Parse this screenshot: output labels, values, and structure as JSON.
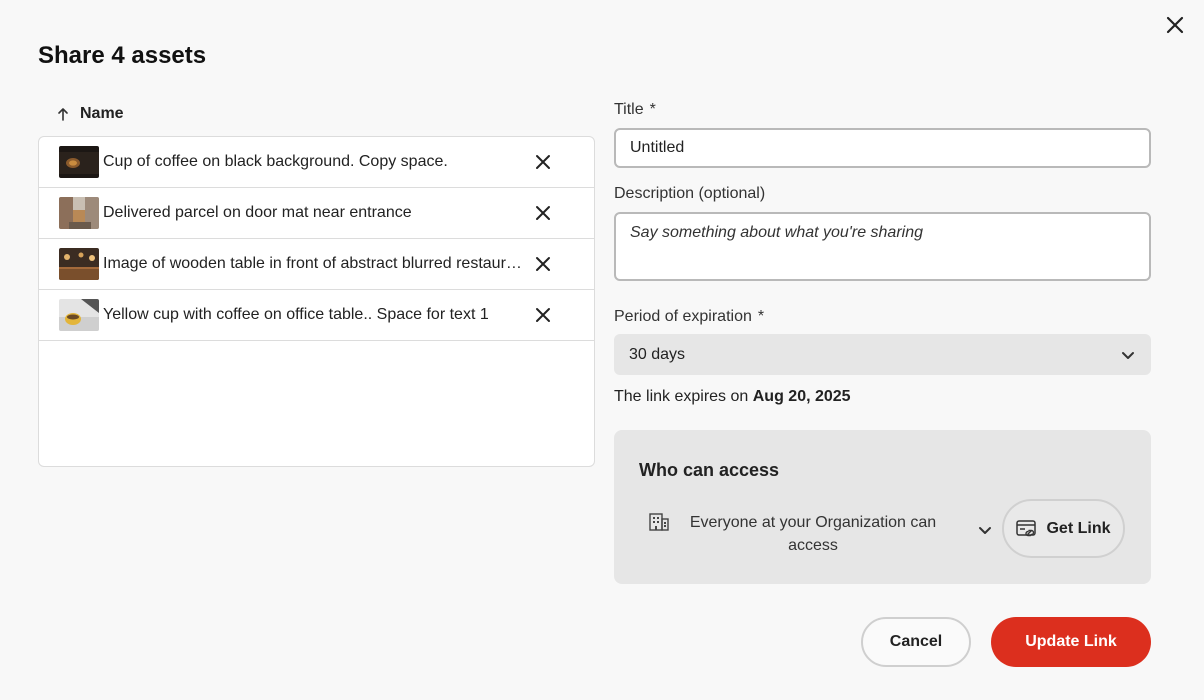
{
  "dialog": {
    "title": "Share 4 assets",
    "close_icon": "close-icon"
  },
  "asset_list": {
    "sort_column": "Name",
    "sort_icon": "arrow-up-icon",
    "items": [
      {
        "name": "Cup of coffee on black background. Copy space.",
        "thumb": "coffee-cup-thumbnail"
      },
      {
        "name": "Delivered parcel on door mat near entrance",
        "thumb": "parcel-thumbnail"
      },
      {
        "name": "Image of wooden table in front of abstract blurred restaurant",
        "thumb": "wooden-table-thumbnail"
      },
      {
        "name": "Yellow cup with coffee on office table.. Space for text 1",
        "thumb": "yellow-cup-thumbnail"
      }
    ]
  },
  "form": {
    "title_label": "Title",
    "required_mark": "*",
    "title_value": "Untitled",
    "description_label": "Description (optional)",
    "description_placeholder": "Say something about what you're sharing",
    "expiration_label": "Period of expiration",
    "expiration_value": "30 days",
    "expires_prefix": "The link expires on",
    "expires_date": "Aug 20, 2025"
  },
  "access": {
    "title": "Who can access",
    "scope_text": "Everyone at your Organization can access",
    "get_link_label": "Get Link"
  },
  "footer": {
    "cancel_label": "Cancel",
    "update_label": "Update Link"
  },
  "colors": {
    "primary_action": "#dc2f1e",
    "panel_background": "#e6e6e6",
    "page_background": "#f8f8f8"
  }
}
